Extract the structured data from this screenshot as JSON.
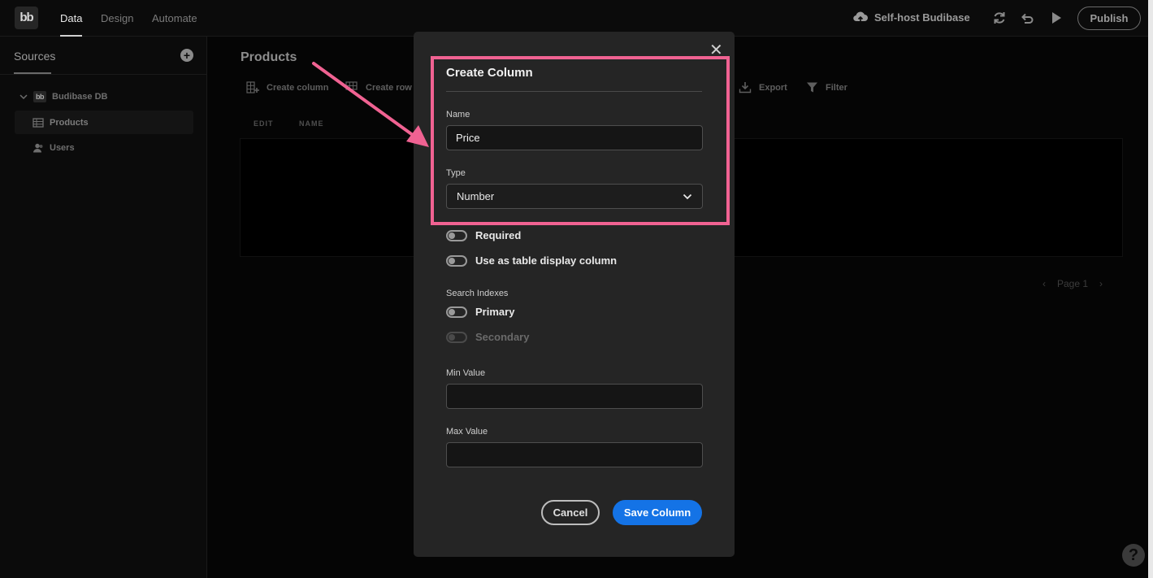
{
  "topbar": {
    "logo": "bb",
    "tabs": [
      {
        "label": "Data",
        "active": true
      },
      {
        "label": "Design",
        "active": false
      },
      {
        "label": "Automate",
        "active": false
      }
    ],
    "selfhost_label": "Self-host Budibase",
    "publish_label": "Publish"
  },
  "sidebar": {
    "title": "Sources",
    "database": {
      "logo": "bb",
      "name": "Budibase DB"
    },
    "items": [
      {
        "label": "Products",
        "icon": "table-icon",
        "selected": true
      },
      {
        "label": "Users",
        "icon": "users-icon",
        "selected": false
      }
    ]
  },
  "main": {
    "title": "Products",
    "toolbar": {
      "create_column": "Create column",
      "create_row": "Create row",
      "export": "Export",
      "filter": "Filter"
    },
    "columns": [
      "EDIT",
      "NAME"
    ],
    "pager": {
      "prev": "‹",
      "label": "Page 1",
      "next": "›"
    }
  },
  "modal": {
    "title": "Create Column",
    "name_label": "Name",
    "name_value": "Price",
    "type_label": "Type",
    "type_value": "Number",
    "toggles": {
      "required": "Required",
      "display_column": "Use as table display column"
    },
    "search_indexes_label": "Search Indexes",
    "indexes": {
      "primary": "Primary",
      "secondary": "Secondary"
    },
    "min_value_label": "Min Value",
    "min_value": "",
    "max_value_label": "Max Value",
    "max_value": "",
    "cancel_label": "Cancel",
    "save_label": "Save Column"
  },
  "help_label": "?",
  "colors": {
    "accent": "#1473e6",
    "annotation": "#f06292",
    "modal_bg": "#252525",
    "app_bg": "#050505"
  }
}
